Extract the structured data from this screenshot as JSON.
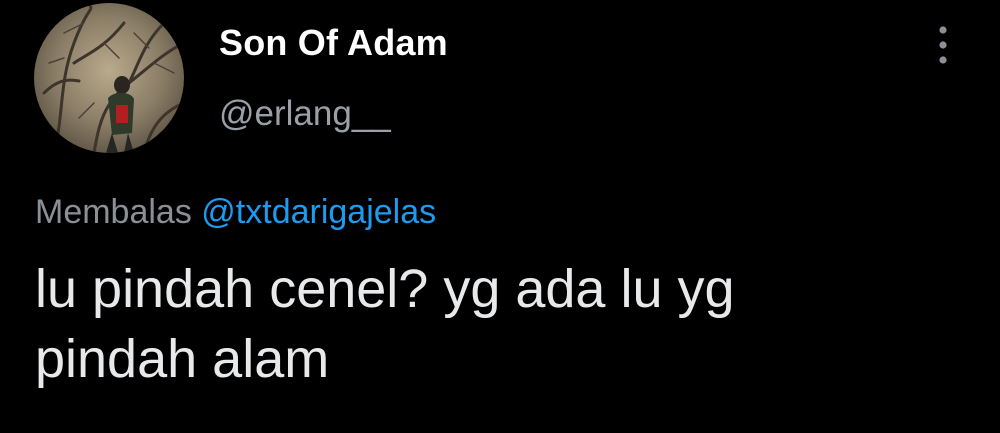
{
  "tweet": {
    "author": {
      "display_name": "Son Of Adam",
      "handle": "@erlang__"
    },
    "reply_to": {
      "prefix": "Membalas",
      "mention": "@txtdarigajelas"
    },
    "text": "lu pindah cenel? yg ada lu yg\npindah alam"
  },
  "icons": {
    "more": "more-vertical-icon",
    "avatar": "avatar-photo"
  },
  "colors": {
    "background": "#000000",
    "name": "#ffffff",
    "handle": "#9aa0a6",
    "mention": "#1d9bf0",
    "body": "#e7e9ea"
  }
}
